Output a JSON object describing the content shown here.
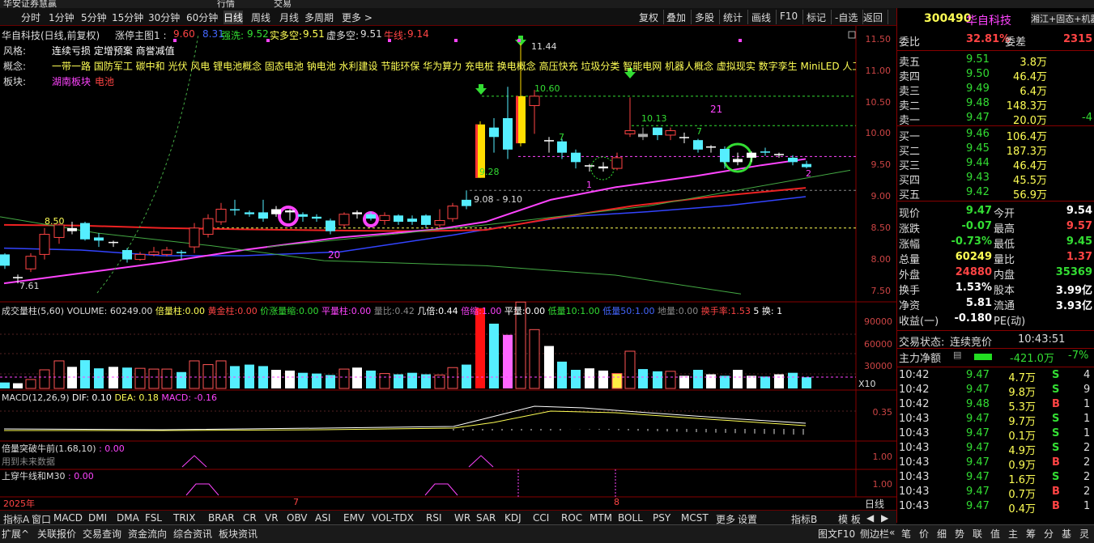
{
  "window": {
    "title": "华安证券慧赢",
    "tab_quote": "行情",
    "tab_trade": "交易"
  },
  "toolbar": {
    "periods": [
      "分时",
      "1分钟",
      "5分钟",
      "15分钟",
      "30分钟",
      "60分钟",
      "日线",
      "周线",
      "月线",
      "多周期",
      "更多 >"
    ],
    "active_period": "日线",
    "right_buttons": [
      "复权",
      "叠加",
      "多股",
      "统计",
      "画线",
      "F10",
      "标记",
      "-自选",
      "返回"
    ]
  },
  "main_chart": {
    "header": {
      "name": "华自科技(日线,前复权)",
      "ind": "涨停主图1 :",
      "v1": "9.60",
      "v2": "8.31",
      "qx_label": "强洗:",
      "qx_val": "9.52",
      "sdk_label": "实多空:",
      "sdk_val": "9.51",
      "xdk_label": "虚多空:",
      "xdk_val": "9.51",
      "nx_label": "牛线:",
      "nx_val": "9.14"
    },
    "info": {
      "fengge_label": "风格:",
      "fengge_val": "连续亏损 定增预案 商誉减值",
      "gainian_label": "概念:",
      "gainian_val": "一带一路 国防军工 碳中和 光伏 风电 锂电池概念 固态电池 钠电池 水利建设 节能环保 华为算力 充电桩 换电概念 高压快充 垃圾分类 智能电网 机器人概念 虚拟现实 数字孪生 MiniLED 人工智",
      "bankuai_label": "板块:",
      "bankuai_v1": "湖南板块",
      "bankuai_v2": "电池"
    },
    "price_labels": [
      "11.44",
      "10.60",
      "10.13",
      "9.28",
      "9.08 - 9.10",
      "8.50",
      "7.61",
      "20",
      "21",
      "7",
      "7",
      "1",
      "2"
    ],
    "y_ticks": [
      "11.50",
      "11.00",
      "10.50",
      "10.00",
      "9.50",
      "9.00",
      "8.50",
      "8.00",
      "7.50"
    ]
  },
  "volume_panel": {
    "label": "成交量柱(5,60) VOLUME: 60249.00",
    "bl": "倍量柱:",
    "bl_v": "0.00",
    "hjz": "黄金柱:",
    "hjz_v": "0.00",
    "jzls": "价涨量缩:",
    "jzls_v": "0.00",
    "plz": "平量柱:",
    "plz_v": "0.00",
    "lb": "量比:",
    "lb_v": "0.42",
    "jb": "几倍:",
    "jb_v": "0.44",
    "bs": "倍缩:",
    "bs_v": "1.00",
    "pl": "平量:",
    "pl_v": "0.00",
    "dl10": "低量10:",
    "dl10_v": "1.00",
    "dl50": "低量50:",
    "dl50_v": "1.00",
    "dl": "地量:",
    "dl_v": "0.00",
    "hsl": "换手率:",
    "hsl_v": "1.53",
    "extra": "5 换: 1",
    "y_ticks": [
      "90000",
      "60000",
      "30000"
    ],
    "unit": "X10"
  },
  "macd_panel": {
    "label": "MACD(12,26,9)",
    "dif": "DIF: 0.10",
    "dea": "DEA: 0.18",
    "macd": "MACD: -0.16",
    "y_tick": "0.35"
  },
  "panel3": {
    "label": "倍量突破牛前(1.68,10)",
    "val": ": 0.00",
    "note": "用到未来数据",
    "y_tick": "1.00"
  },
  "panel4": {
    "label": "上穿牛线和M30",
    "val": ": 0.00",
    "y_tick": "1.00"
  },
  "x_axis": {
    "labels": [
      "2025年",
      "7",
      "8"
    ],
    "period_btn": "日线"
  },
  "indicator_tabs": [
    "指标A",
    "窗口",
    "MACD",
    "DMI",
    "DMA",
    "FSL",
    "TRIX",
    "BRAR",
    "CR",
    "VR",
    "OBV",
    "ASI",
    "EMV",
    "VOL-TDX",
    "RSI",
    "WR",
    "SAR",
    "KDJ",
    "CCI",
    "ROC",
    "MTM",
    "BOLL",
    "PSY",
    "MCST",
    "更多",
    "设置"
  ],
  "indicator_tabs_right": [
    "指标B",
    "模 板"
  ],
  "status_tabs": [
    "扩展^",
    "关联报价",
    "交易查询",
    "资金流向",
    "综合资讯",
    "板块资讯"
  ],
  "status_right": [
    "图文F10",
    "侧边栏"
  ],
  "status_quote_tabs": [
    "笔",
    "价",
    "细",
    "势",
    "联",
    "值",
    "主",
    "筹",
    "分",
    "基",
    "灵"
  ],
  "stock": {
    "code": "300490",
    "name": "华自科技",
    "tag": "湘江+固态+机器"
  },
  "order_book": {
    "weibi_label": "委比",
    "weibi_val": "32.81%",
    "weicha_label": "委差",
    "weicha_val": "2315",
    "asks": [
      {
        "label": "卖五",
        "price": "9.51",
        "vol": "3.8万",
        "d": ""
      },
      {
        "label": "卖四",
        "price": "9.50",
        "vol": "46.4万",
        "d": ""
      },
      {
        "label": "卖三",
        "price": "9.49",
        "vol": "6.4万",
        "d": ""
      },
      {
        "label": "卖二",
        "price": "9.48",
        "vol": "148.3万",
        "d": ""
      },
      {
        "label": "卖一",
        "price": "9.47",
        "vol": "20.0万",
        "d": "-4"
      }
    ],
    "bids": [
      {
        "label": "买一",
        "price": "9.46",
        "vol": "106.4万"
      },
      {
        "label": "买二",
        "price": "9.45",
        "vol": "187.3万"
      },
      {
        "label": "买三",
        "price": "9.44",
        "vol": "46.4万"
      },
      {
        "label": "买四",
        "price": "9.43",
        "vol": "45.5万"
      },
      {
        "label": "买五",
        "price": "9.42",
        "vol": "56.9万"
      }
    ]
  },
  "stats": [
    {
      "l1": "现价",
      "v1": "9.47",
      "l2": "今开",
      "v2": "9.54",
      "c1": "#33dd33",
      "c2": "#fff"
    },
    {
      "l1": "涨跌",
      "v1": "-0.07",
      "l2": "最高",
      "v2": "9.57",
      "c1": "#33dd33",
      "c2": "#ff4444"
    },
    {
      "l1": "涨幅",
      "v1": "-0.73%",
      "l2": "最低",
      "v2": "9.45",
      "c1": "#33dd33",
      "c2": "#33dd33"
    },
    {
      "l1": "总量",
      "v1": "60249",
      "l2": "量比",
      "v2": "1.37",
      "c1": "#ffff55",
      "c2": "#ff4444"
    },
    {
      "l1": "外盘",
      "v1": "24880",
      "l2": "内盘",
      "v2": "35369",
      "c1": "#ff4444",
      "c2": "#33dd33"
    },
    {
      "l1": "换手",
      "v1": "1.53%",
      "l2": "股本",
      "v2": "3.99亿",
      "c1": "#fff",
      "c2": "#fff"
    },
    {
      "l1": "净资",
      "v1": "5.81",
      "l2": "流通",
      "v2": "3.93亿",
      "c1": "#fff",
      "c2": "#fff"
    },
    {
      "l1": "收益(一)",
      "v1": "-0.180",
      "l2": "PE(动)",
      "v2": "",
      "c1": "#fff",
      "c2": "#fff"
    }
  ],
  "trade_state": {
    "label": "交易状态:",
    "val": "连续竞价",
    "time": "10:43:51"
  },
  "main_flow": {
    "label": "主力净额",
    "val": "-421.0万",
    "pct": "-7%"
  },
  "ticks": [
    {
      "t": "10:42",
      "p": "9.47",
      "v": "4.7万",
      "s": "S",
      "n": "4"
    },
    {
      "t": "10:42",
      "p": "9.47",
      "v": "9.8万",
      "s": "S",
      "n": "9"
    },
    {
      "t": "10:42",
      "p": "9.48",
      "v": "5.3万",
      "s": "B",
      "n": "1"
    },
    {
      "t": "10:43",
      "p": "9.47",
      "v": "9.7万",
      "s": "S",
      "n": "1"
    },
    {
      "t": "10:43",
      "p": "9.47",
      "v": "0.1万",
      "s": "S",
      "n": "1"
    },
    {
      "t": "10:43",
      "p": "9.47",
      "v": "4.9万",
      "s": "S",
      "n": "2"
    },
    {
      "t": "10:43",
      "p": "9.47",
      "v": "0.9万",
      "s": "B",
      "n": "2"
    },
    {
      "t": "10:43",
      "p": "9.47",
      "v": "1.6万",
      "s": "S",
      "n": "2"
    },
    {
      "t": "10:43",
      "p": "9.47",
      "v": "0.7万",
      "s": "B",
      "n": "2"
    },
    {
      "t": "10:43",
      "p": "9.47",
      "v": "0.4万",
      "s": "B",
      "n": "1"
    }
  ]
}
